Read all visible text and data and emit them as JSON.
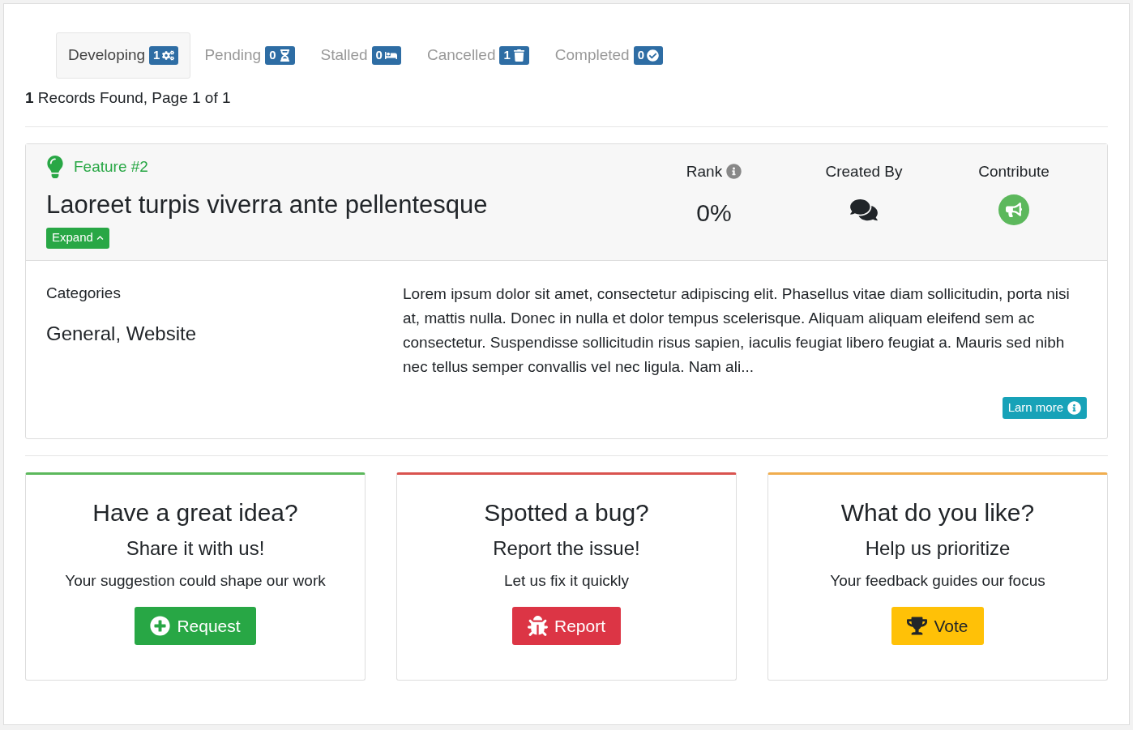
{
  "tabs": [
    {
      "label": "Developing",
      "count": "1",
      "kind": "developing",
      "selected": true
    },
    {
      "label": "Pending",
      "count": "0",
      "kind": "pending",
      "selected": false
    },
    {
      "label": "Stalled",
      "count": "0",
      "kind": "stalled",
      "selected": false
    },
    {
      "label": "Cancelled",
      "count": "1",
      "kind": "cancelled",
      "selected": false
    },
    {
      "label": "Completed",
      "count": "0",
      "kind": "completed",
      "selected": false
    }
  ],
  "records": {
    "count": "1",
    "text": "Records Found, Page 1 of 1"
  },
  "feature": {
    "tag": "Feature #2",
    "title": "Laoreet turpis viverra ante pellentesque",
    "expand": "Expand",
    "rank_label": "Rank",
    "rank": "0%",
    "created_by_label": "Created By",
    "contribute_label": "Contribute",
    "categories_label": "Categories",
    "categories": "General, Website",
    "description": "Lorem ipsum dolor sit amet, consectetur adipiscing elit. Phasellus vitae diam sollicitudin, porta nisi at, mattis nulla. Donec in nulla et dolor tempus scelerisque. Aliquam aliquam eleifend sem ac consectetur. Suspendisse sollicitudin risus sapien, iaculis feugiat libero feugiat a. Mauris sed nibh nec tellus semper convallis vel nec ligula. Nam ali...",
    "learn_more": "Larn more"
  },
  "cards": [
    {
      "title": "Have a great idea?",
      "subtitle": "Share it with us!",
      "text": "Your suggestion could shape our work",
      "button": "Request",
      "kind": "request",
      "color": "#5cb85c"
    },
    {
      "title": "Spotted a bug?",
      "subtitle": "Report the issue!",
      "text": "Let us fix it quickly",
      "button": "Report",
      "kind": "report",
      "color": "#d9534f"
    },
    {
      "title": "What do you like?",
      "subtitle": "Help us prioritize",
      "text": "Your feedback guides our focus",
      "button": "Vote",
      "kind": "vote",
      "color": "#f0ad4e"
    }
  ]
}
